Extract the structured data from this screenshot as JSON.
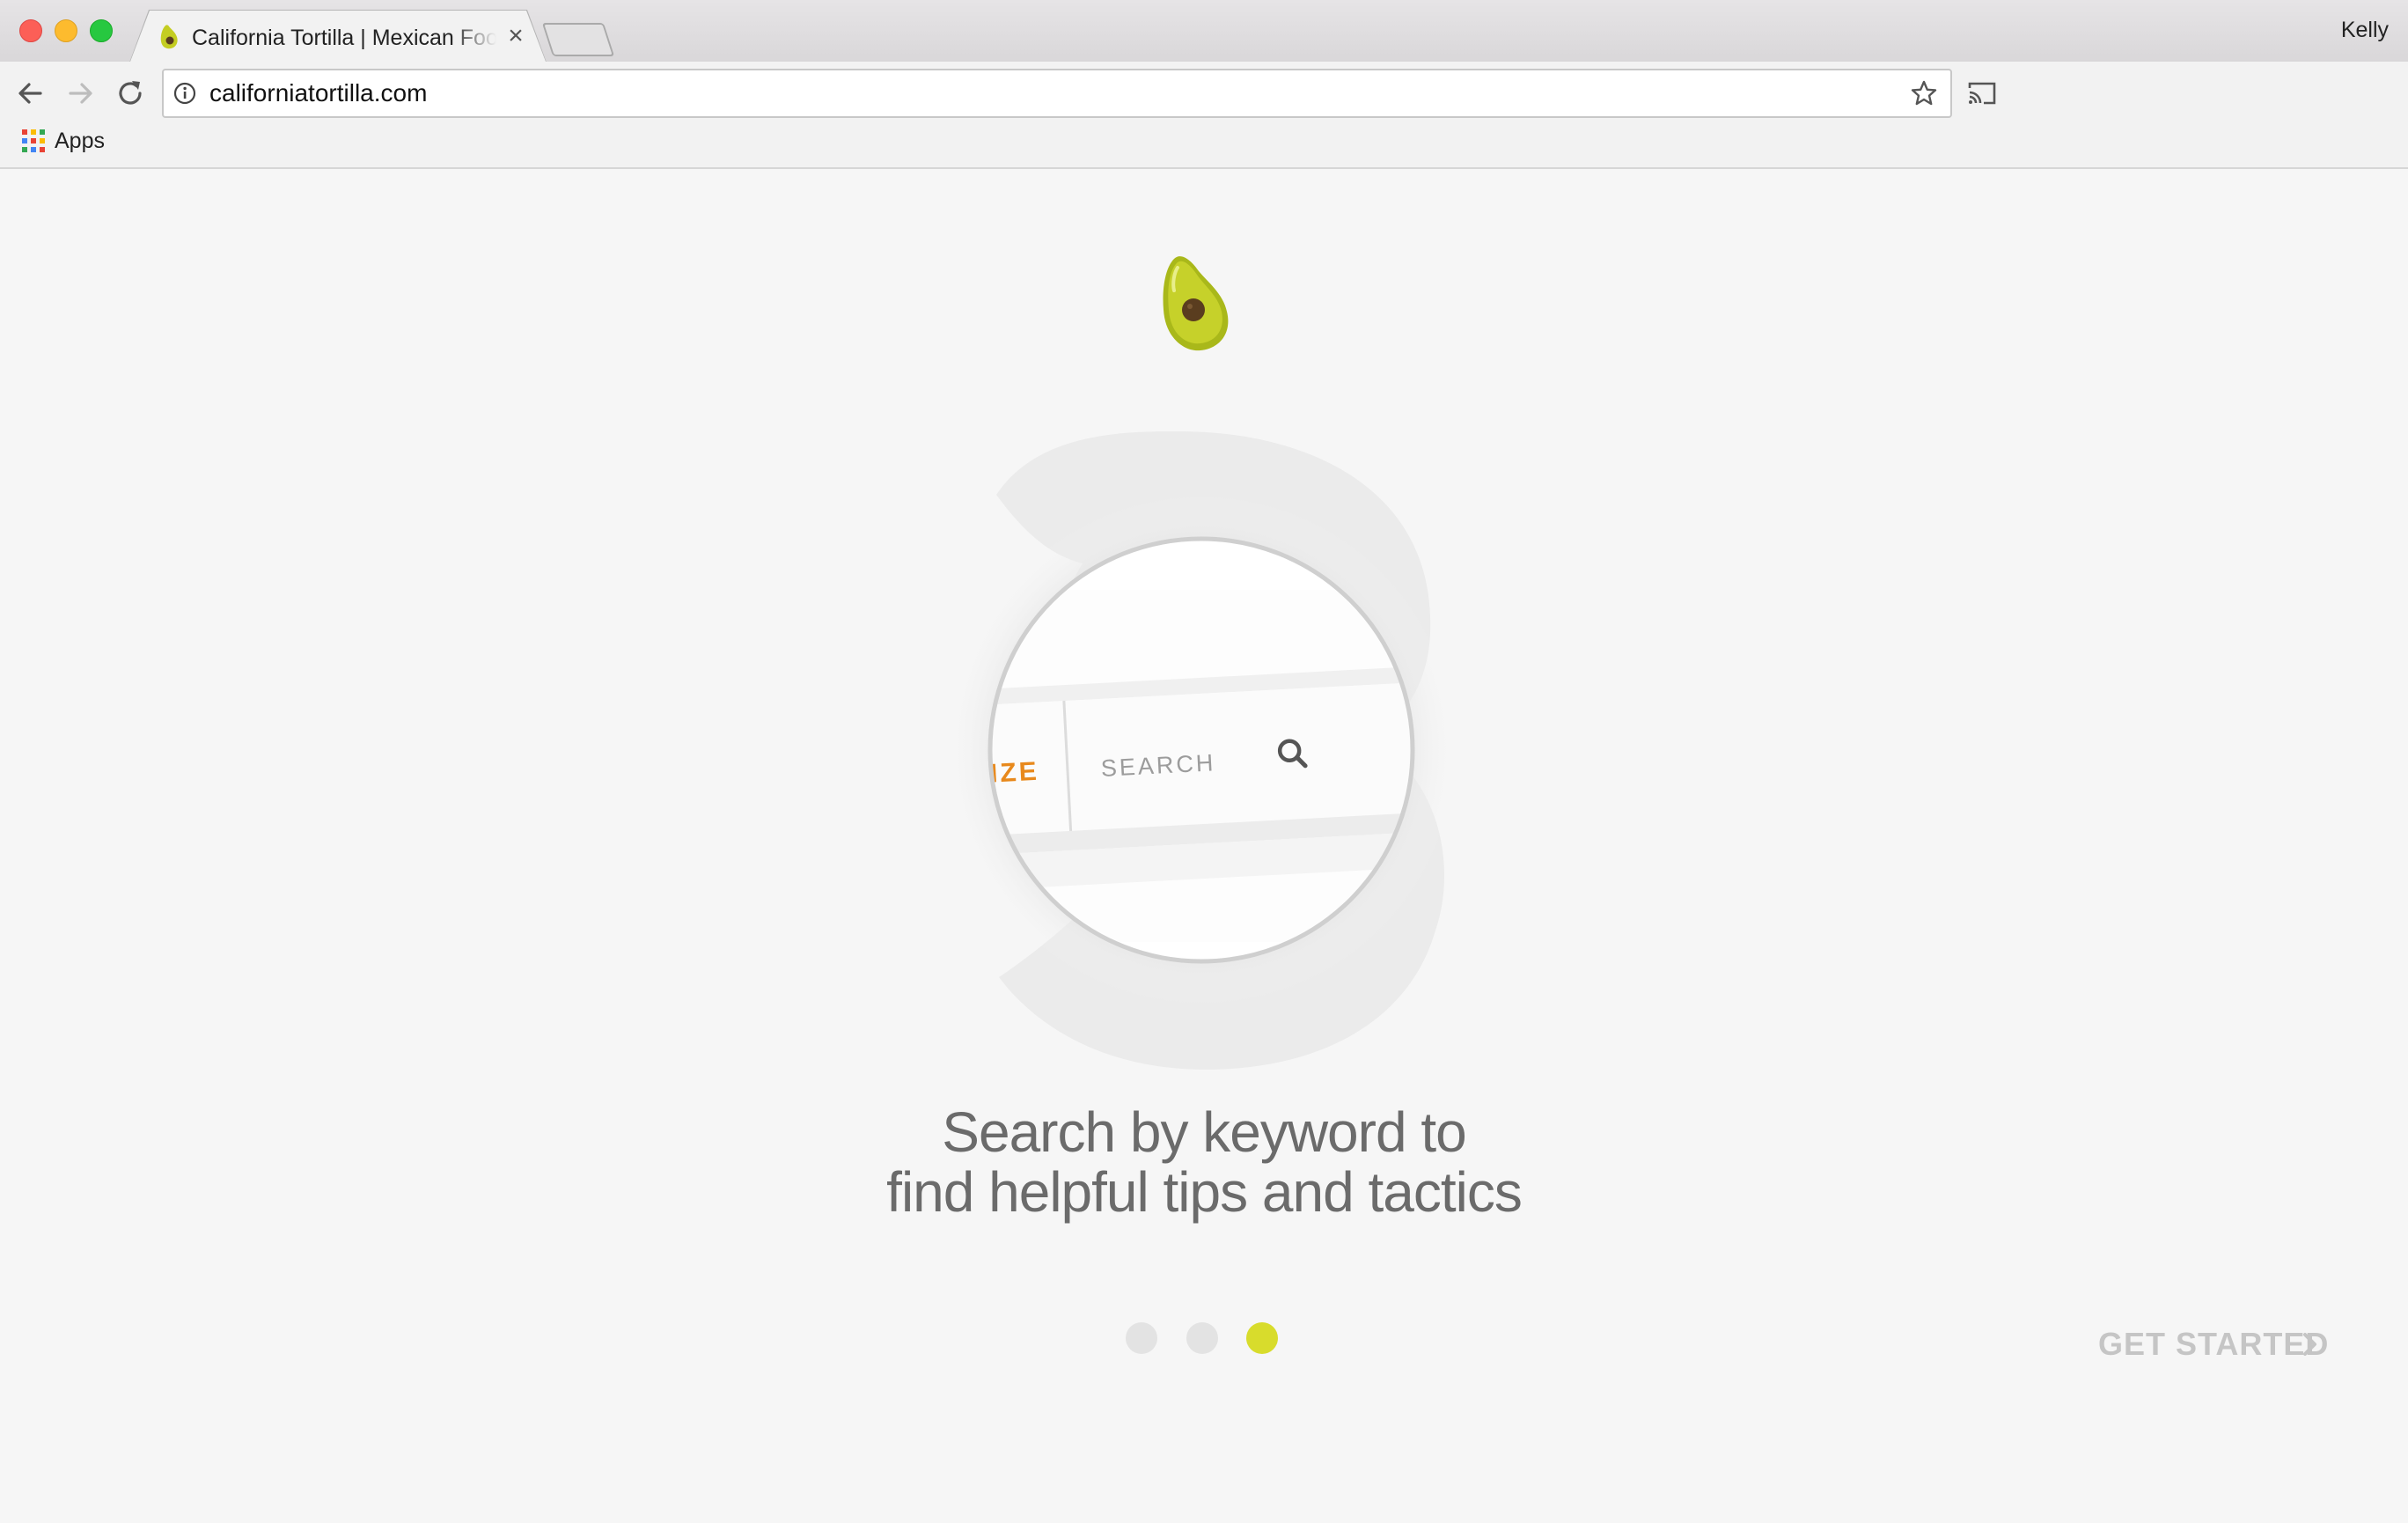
{
  "browser": {
    "tab": {
      "title": "California Tortilla | Mexican Food",
      "close_glyph": "×"
    },
    "profile_name": "Kelly",
    "address_bar": {
      "url": "californiatortilla.com"
    },
    "bookmarks": {
      "apps_label": "Apps"
    }
  },
  "page": {
    "hero": {
      "search_bar_left_text": "IZE",
      "search_placeholder": "SEARCH"
    },
    "headline_line1": "Search by keyword to",
    "headline_line2": "find helpful tips and tactics",
    "pager": {
      "count": 3,
      "active_index": 3
    },
    "cta_label": "GET STARTED"
  },
  "colors": {
    "avocado_green": "#b8c41e",
    "pit_brown": "#5a3d1f",
    "accent_orange": "#e8891c",
    "active_dot": "#d8dc2c",
    "inactive_dot": "#e3e3e3",
    "cta_gray": "#c5c5c5"
  }
}
